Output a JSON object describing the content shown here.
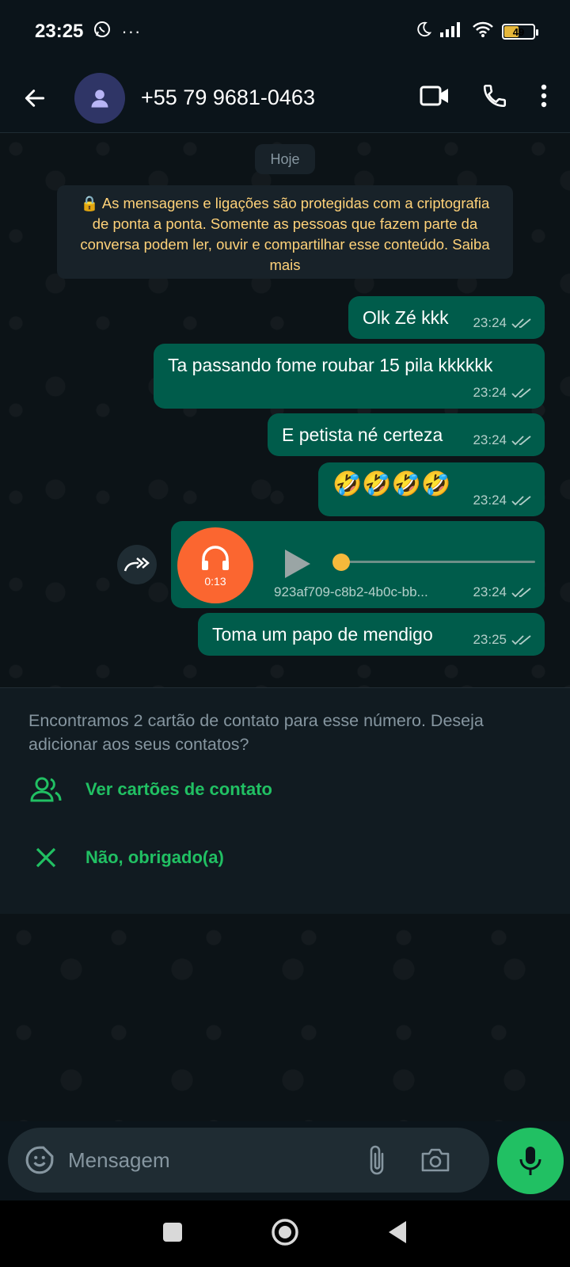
{
  "status_bar": {
    "time": "23:25",
    "battery": "49"
  },
  "header": {
    "contact_name": "+55 79 9681-0463"
  },
  "chat": {
    "date_chip": "Hoje",
    "encryption_notice": "🔒 As mensagens e ligações são protegidas com a criptografia de ponta a ponta. Somente as pessoas que fazem parte da conversa podem ler, ouvir e compartilhar esse conteúdo. Saiba mais",
    "messages": [
      {
        "text": "Olk Zé kkk",
        "time": "23:24"
      },
      {
        "text": "Ta passando fome roubar  15 pila kkkkkk",
        "time": "23:24"
      },
      {
        "text": "E petista né certeza",
        "time": "23:24"
      },
      {
        "text": "🤣🤣🤣🤣",
        "time": "23:24"
      },
      {
        "type": "audio",
        "duration": "0:13",
        "filename": "923af709-c8b2-4b0c-bb...",
        "time": "23:24",
        "progress": 0
      },
      {
        "text": "Toma um papo de mendigo",
        "time": "23:25"
      }
    ]
  },
  "contact_card_prompt": {
    "message": "Encontramos 2 cartão de contato para esse número. Deseja adicionar aos seus contatos?",
    "view_label": "Ver cartões de contato",
    "dismiss_label": "Não, obrigado(a)"
  },
  "composer": {
    "placeholder": "Mensagem"
  },
  "colors": {
    "bubble_out": "#005c4b",
    "accent_green": "#21c063",
    "audio_avatar": "#fb6630",
    "notice_text": "#ffd279"
  },
  "icons": [
    "whatsapp-icon",
    "more-dots-icon",
    "moon-icon",
    "signal-icon",
    "wifi-icon",
    "battery-icon",
    "back-arrow-icon",
    "person-icon",
    "video-call-icon",
    "phone-icon",
    "kebab-menu-icon",
    "double-check-icon",
    "headphones-icon",
    "play-icon",
    "forward-icon",
    "contacts-icon",
    "close-icon",
    "sticker-icon",
    "attach-icon",
    "camera-icon",
    "mic-icon",
    "recents-icon",
    "home-icon",
    "nav-back-icon"
  ]
}
